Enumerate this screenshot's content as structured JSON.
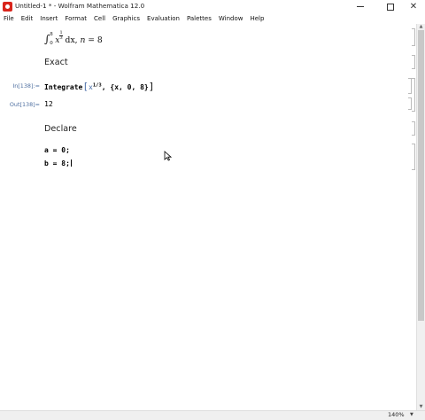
{
  "window": {
    "title": "Untitled-1 * - Wolfram Mathematica 12.0"
  },
  "menu": [
    "File",
    "Edit",
    "Insert",
    "Format",
    "Cell",
    "Graphics",
    "Evaluation",
    "Palettes",
    "Window",
    "Help"
  ],
  "cells": {
    "integral": {
      "prefix": "∫",
      "lower": "0",
      "upper": "8",
      "var": "x",
      "exp_num": "1",
      "exp_den": "3",
      "diff": " dx, ",
      "n": "n",
      "eq": " = 8"
    },
    "section_exact": "Exact",
    "input_label": "In[138]:=",
    "input": {
      "func": "Integrate",
      "lbr": "[",
      "x": "x",
      "exp": "1/3",
      "rest": ", {x, 0, 8}",
      "rbr": "]"
    },
    "output_label": "Out[138]=",
    "output_value": "12",
    "section_declare": "Declare",
    "declare_a": "a = 0;",
    "declare_b": "b = 8;"
  },
  "status": {
    "zoom": "140%"
  }
}
